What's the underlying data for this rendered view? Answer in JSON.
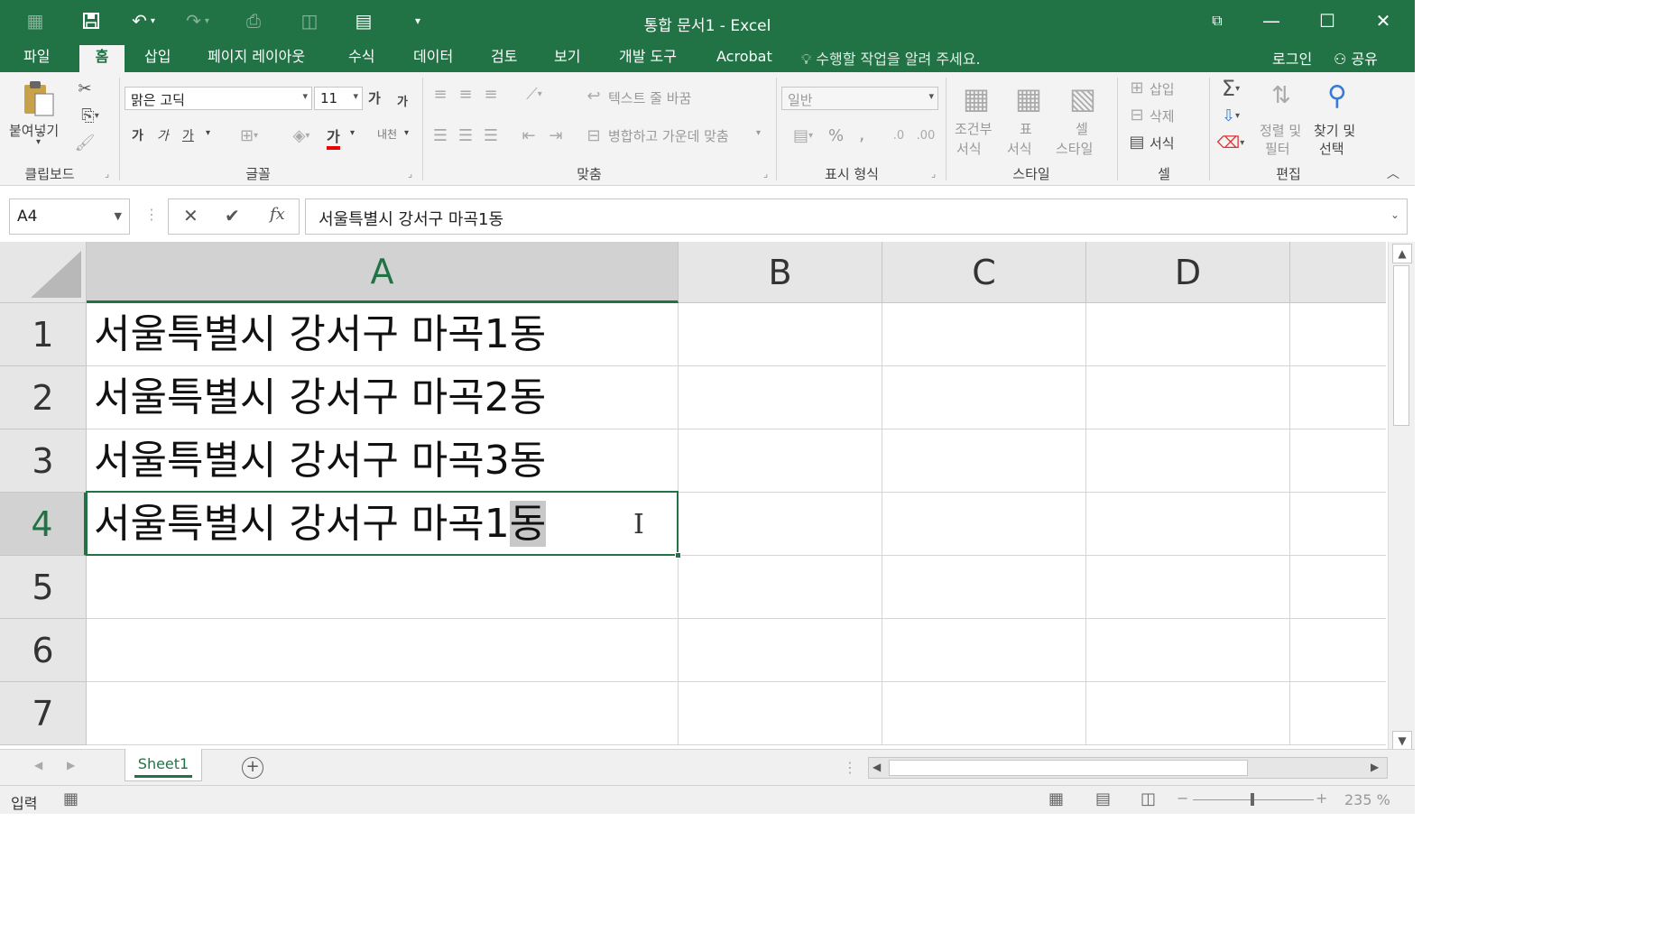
{
  "titlebar": {
    "title": "통합 문서1 - Excel",
    "quick_access": [
      "grid-icon",
      "save-icon",
      "undo-icon",
      "redo-icon",
      "print-preview-icon",
      "camera-icon",
      "form-icon",
      "customize-icon"
    ],
    "window_buttons": {
      "ribbon_options": "⧉",
      "minimize": "—",
      "maximize": "☐",
      "close": "✕"
    }
  },
  "tabs": {
    "items": [
      "파일",
      "홈",
      "삽입",
      "페이지 레이아웃",
      "수식",
      "데이터",
      "검토",
      "보기",
      "개발 도구",
      "Acrobat"
    ],
    "active": "홈",
    "tell_me": "수행할 작업을 알려 주세요.",
    "login": "로그인",
    "share": "공유"
  },
  "ribbon": {
    "clipboard": {
      "paste_label": "붙여넣기",
      "group_label": "클립보드"
    },
    "font": {
      "font_name": "맑은 고딕",
      "font_size": "11",
      "grow": "가",
      "shrink": "가",
      "bold": "가",
      "italic": "가",
      "underline": "가",
      "font_color": "가",
      "phonetic": "내천",
      "group_label": "글꼴"
    },
    "alignment": {
      "wrap_text": "텍스트 줄 바꿈",
      "merge_center": "병합하고 가운데 맞춤",
      "group_label": "맞춤"
    },
    "number": {
      "format": "일반",
      "percent": "%",
      "comma": ",",
      "group_label": "표시 형식"
    },
    "styles": {
      "conditional_label_1": "조건부",
      "conditional_label_2": "서식",
      "table_label_1": "표",
      "table_label_2": "서식",
      "cell_style_label_1": "셀",
      "cell_style_label_2": "스타일",
      "group_label": "스타일"
    },
    "cells": {
      "insert": "삽입",
      "delete": "삭제",
      "format": "서식",
      "group_label": "셀"
    },
    "editing": {
      "sort_label_1": "정렬 및",
      "sort_label_2": "필터",
      "find_label_1": "찾기 및",
      "find_label_2": "선택",
      "group_label": "편집"
    }
  },
  "formula_bar": {
    "name_box": "A4",
    "cancel": "✕",
    "enter": "✔",
    "fx": "fx",
    "content": "서울특별시 강서구 마곡1동"
  },
  "grid": {
    "columns": [
      "A",
      "B",
      "C",
      "D"
    ],
    "selected_column": "A",
    "rows": [
      "1",
      "2",
      "3",
      "4",
      "5",
      "6",
      "7"
    ],
    "selected_row": "4",
    "cells": {
      "A1": "서울특별시 강서구 마곡1동",
      "A2": "서울특별시 강서구 마곡2동",
      "A3": "서울특별시 강서구 마곡3동",
      "A4_prefix": "서울특별시 강서구 마곡1",
      "A4_selected": "동"
    }
  },
  "sheets": {
    "tabs": [
      "Sheet1"
    ],
    "active": "Sheet1"
  },
  "statusbar": {
    "mode": "입력",
    "zoom": "235 %"
  },
  "colors": {
    "brand": "#217346",
    "ribbon_bg": "#f3f3f3",
    "header_bg": "#e6e6e6"
  }
}
